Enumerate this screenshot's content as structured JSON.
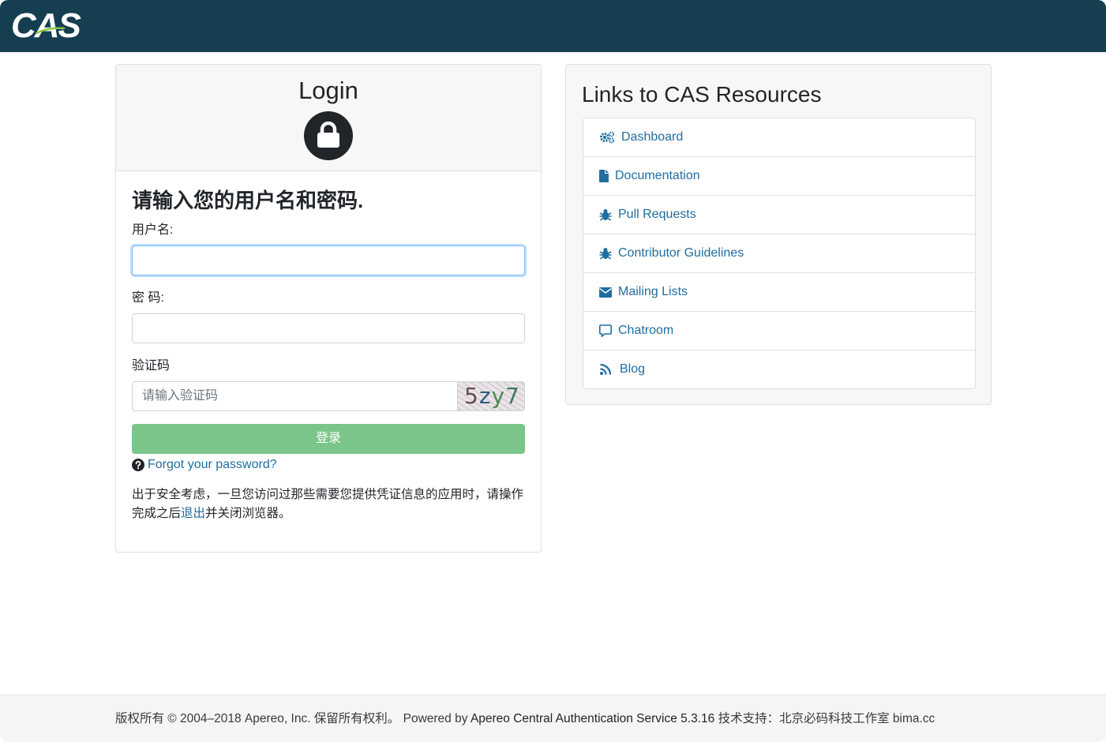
{
  "header": {
    "logo_text": "CAS",
    "brand_color": "#153e50"
  },
  "login": {
    "title": "Login",
    "prompt": "请输入您的用户名和密码.",
    "username_label": "用户名:",
    "username_value": "",
    "password_label": "密 码:",
    "password_value": "",
    "captcha_label": "验证码",
    "captcha_placeholder": "请输入验证码",
    "captcha_code": [
      "5",
      "z",
      "y",
      "7"
    ],
    "submit_label": "登录",
    "submit_color": "#7cc58a",
    "forgot_label": "Forgot your password?",
    "notice_before": "出于安全考虑，一旦您访问过那些需要您提供凭证信息的应用时，请操作完成之后",
    "notice_link": "退出",
    "notice_after": "并关闭浏览器。"
  },
  "resources": {
    "title": "Links to CAS Resources",
    "link_color": "#1f6ea0",
    "items": [
      {
        "label": "Dashboard",
        "icon": "gears-icon"
      },
      {
        "label": "Documentation",
        "icon": "file-icon"
      },
      {
        "label": "Pull Requests",
        "icon": "bug-icon"
      },
      {
        "label": "Contributor Guidelines",
        "icon": "bug-icon"
      },
      {
        "label": "Mailing Lists",
        "icon": "envelope-icon"
      },
      {
        "label": "Chatroom",
        "icon": "comment-icon"
      },
      {
        "label": "Blog",
        "icon": "rss-icon"
      }
    ]
  },
  "footer": {
    "copyright": "版权所有 © 2004–2018 Apereo, Inc. 保留所有权利。",
    "powered_prefix": "Powered by",
    "powered_product": "Apereo Central Authentication Service 5.3.16",
    "support": "技术支持：北京必码科技工作室 bima.cc"
  }
}
